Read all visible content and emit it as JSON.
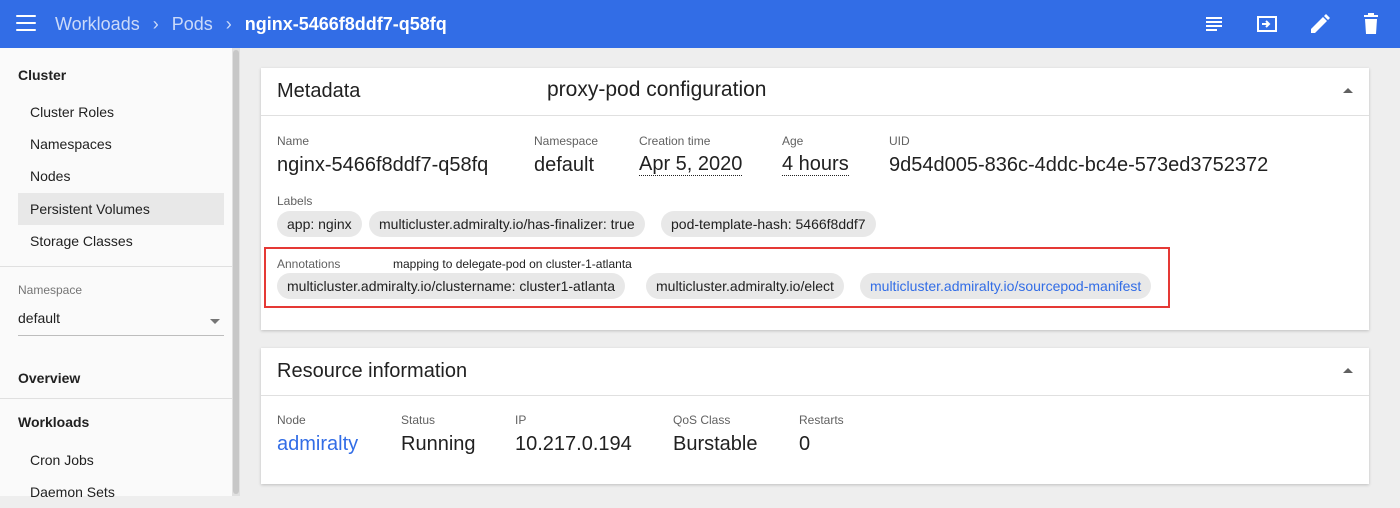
{
  "header": {
    "breadcrumbs": [
      "Workloads",
      "Pods"
    ],
    "current": "nginx-5466f8ddf7-q58fq",
    "bar_color": "#326de6"
  },
  "sidebar": {
    "cluster_heading": "Cluster",
    "cluster_items": [
      "Cluster Roles",
      "Namespaces",
      "Nodes",
      "Persistent Volumes",
      "Storage Classes"
    ],
    "namespace_label": "Namespace",
    "namespace_value": "default",
    "overview": "Overview",
    "workloads_heading": "Workloads",
    "workload_items": [
      "Cron Jobs",
      "Daemon Sets"
    ]
  },
  "metadata": {
    "title": "Metadata",
    "overlay_title": "proxy-pod configuration",
    "name_label": "Name",
    "name": "nginx-5466f8ddf7-q58fq",
    "namespace_label": "Namespace",
    "namespace": "default",
    "creation_label": "Creation time",
    "creation": "Apr 5, 2020",
    "age_label": "Age",
    "age": "4 hours",
    "uid_label": "UID",
    "uid": "9d54d005-836c-4ddc-bc4e-573ed3752372",
    "labels_label": "Labels",
    "labels": [
      "app: nginx",
      "multicluster.admiralty.io/has-finalizer: true",
      "pod-template-hash: 5466f8ddf7"
    ],
    "annotations_label": "Annotations",
    "annotations_note": "mapping to delegate-pod on cluster-1-atlanta",
    "annotations": [
      "multicluster.admiralty.io/clustername: cluster1-atlanta",
      "multicluster.admiralty.io/elect",
      "multicluster.admiralty.io/sourcepod-manifest"
    ]
  },
  "resource": {
    "title": "Resource information",
    "node_label": "Node",
    "node": "admiralty",
    "status_label": "Status",
    "status": "Running",
    "ip_label": "IP",
    "ip": "10.217.0.194",
    "qos_label": "QoS Class",
    "qos": "Burstable",
    "restarts_label": "Restarts",
    "restarts": "0"
  },
  "icons": [
    "menu-icon",
    "logs-icon",
    "exec-icon",
    "edit-icon",
    "delete-icon",
    "collapse-icon"
  ]
}
